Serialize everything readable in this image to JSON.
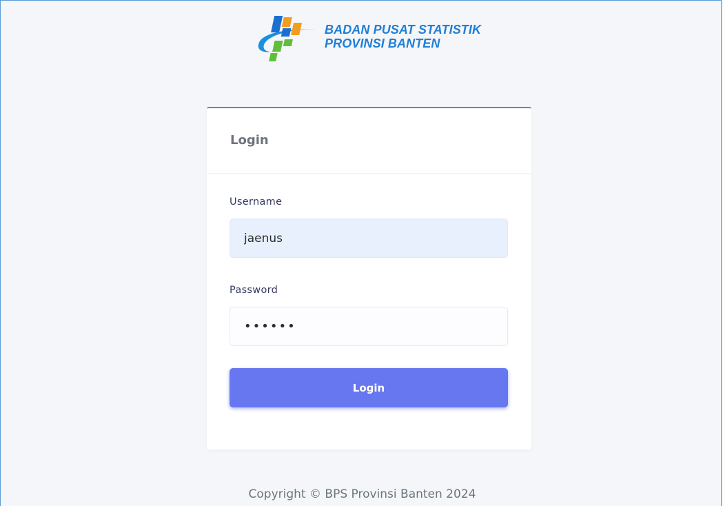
{
  "brand": {
    "line1": "BADAN PUSAT STATISTIK",
    "line2": "PROVINSI BANTEN",
    "logo_icon": "bps-logo-icon",
    "text_color": "#1f7fd6"
  },
  "login_card": {
    "title": "Login",
    "accent_color": "#6777ef",
    "username": {
      "label": "Username",
      "value": "jaenus"
    },
    "password": {
      "label": "Password",
      "value": "••••••"
    },
    "submit_label": "Login"
  },
  "footer": {
    "copyright": "Copyright © BPS Provinsi Banten 2024"
  }
}
